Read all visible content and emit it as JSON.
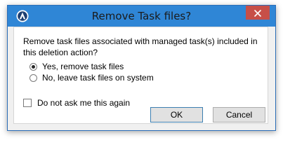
{
  "window": {
    "title": "Remove Task files?",
    "icon": "app-logo-icon",
    "close_icon": "close-icon"
  },
  "dialog": {
    "message": "Remove task files associated with managed task(s) included in this deletion action?",
    "options": [
      {
        "label": "Yes, remove task files",
        "checked": true
      },
      {
        "label": "No, leave task files on system",
        "checked": false
      }
    ],
    "dont_ask_label": "Do not ask me this again",
    "dont_ask_checked": false
  },
  "buttons": {
    "ok_label": "OK",
    "cancel_label": "Cancel"
  },
  "colors": {
    "titlebar": "#2f86d6",
    "close_button": "#c74f48",
    "window_bg": "#f0f0f0",
    "client_bg": "#ffffff"
  }
}
